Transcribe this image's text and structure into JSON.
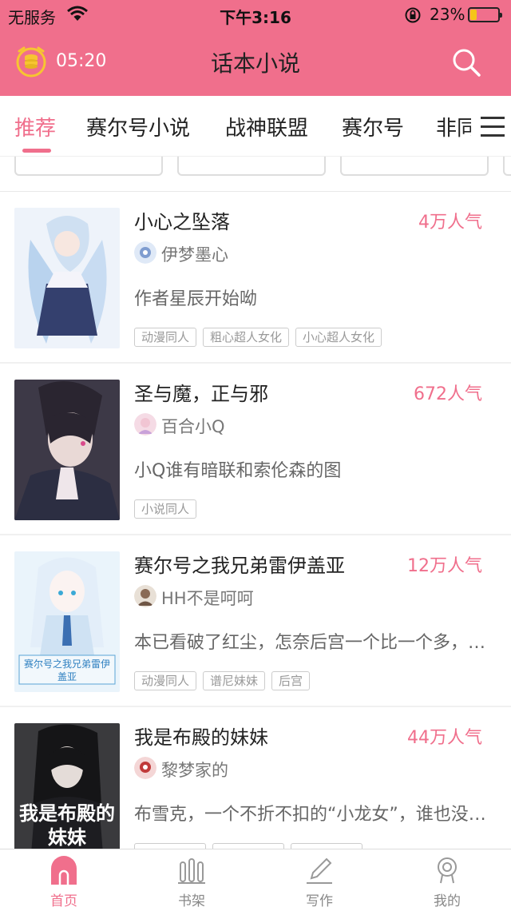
{
  "status_bar": {
    "carrier": "无服务",
    "time": "下午3:16",
    "battery": "23%",
    "battery_level": 0.23
  },
  "header": {
    "timer": "05:20",
    "title": "话本小说"
  },
  "tabs": [
    {
      "label": "推荐",
      "active": true
    },
    {
      "label": "赛尔号小说",
      "active": false
    },
    {
      "label": "战神联盟",
      "active": false
    },
    {
      "label": "赛尔号",
      "active": false
    },
    {
      "label": "非同",
      "active": false
    }
  ],
  "stories": [
    {
      "title": "小心之坠落",
      "popularity": "4万人气",
      "author": "伊梦墨心",
      "description": "作者星辰开始呦",
      "tags": [
        "动漫同人",
        "粗心超人女化",
        "小心超人女化"
      ]
    },
    {
      "title": "圣与魔，正与邪",
      "popularity": "672人气",
      "author": "百合小Q",
      "description": "小Q谁有暗联和索伦森的图",
      "tags": [
        "小说同人"
      ]
    },
    {
      "title": "赛尔号之我兄弟雷伊盖亚",
      "popularity": "12万人气",
      "author": "HH不是呵呵",
      "description": "本已看破了红尘，怎奈后宫一个比一个多，而且一个比一个美",
      "tags": [
        "动漫同人",
        "谱尼妹妹",
        "后宫"
      ],
      "cover_text": "赛尔号之我兄弟雷伊盖亚"
    },
    {
      "title": "我是布殿的妹妹",
      "popularity": "44万人气",
      "author": "黎梦家的",
      "description": "布雪克，一个不折不扣的“小龙女”，谁也没想到她会",
      "tags": [
        "",
        "",
        ""
      ],
      "cover_text": "我是布殿的妹妹"
    }
  ],
  "bottom_nav": [
    {
      "label": "首页",
      "icon": "home-icon",
      "active": true
    },
    {
      "label": "书架",
      "icon": "bookshelf-icon",
      "active": false
    },
    {
      "label": "写作",
      "icon": "pen-icon",
      "active": false
    },
    {
      "label": "我的",
      "icon": "profile-icon",
      "active": false
    }
  ],
  "colors": {
    "accent": "#f06f8c"
  }
}
